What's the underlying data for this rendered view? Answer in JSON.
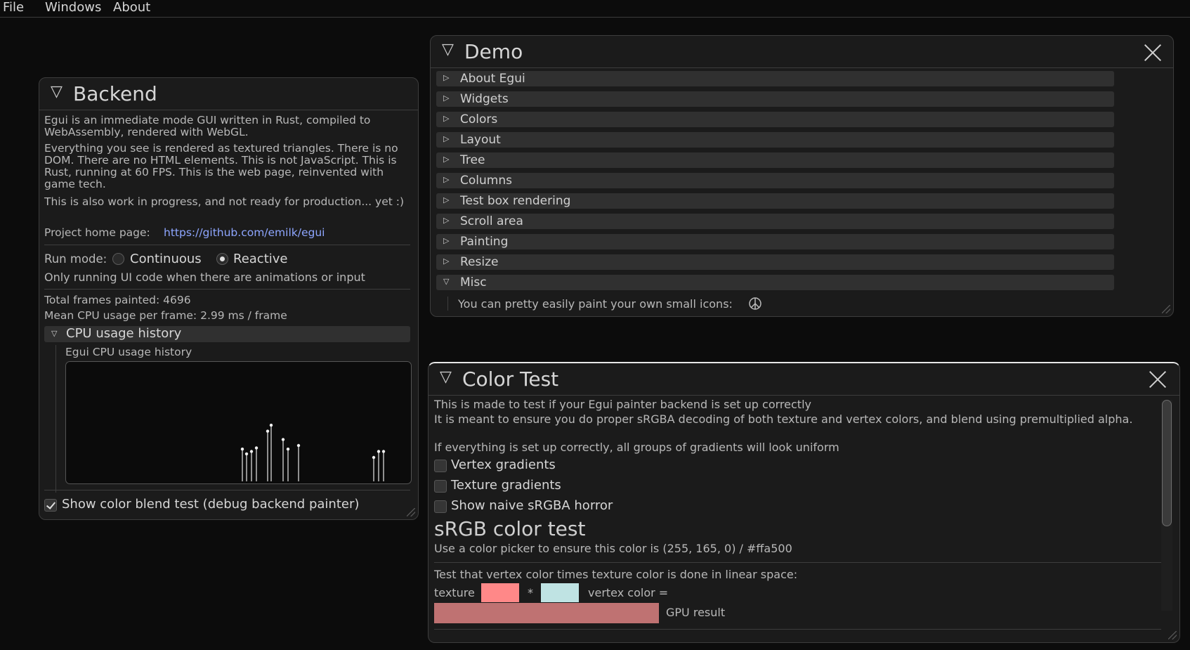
{
  "menu": {
    "file": "File",
    "windows": "Windows",
    "about": "About"
  },
  "backend": {
    "title": "Backend",
    "intro": "Egui is an immediate mode GUI written in Rust, compiled to WebAssembly, rendered with WebGL.",
    "para2": "Everything you see is rendered as textured triangles. There is no DOM. There are no HTML elements. This is not JavaScript. This is Rust, running at 60 FPS. This is the web page, reinvented with game tech.",
    "para3": "This is also work in progress, and not ready for production... yet :)",
    "home_label": "Project home page:",
    "home_link": "https://github.com/emilk/egui",
    "run_mode_label": "Run mode:",
    "run_modes": [
      "Continuous",
      "Reactive"
    ],
    "selected_run_mode": "Reactive",
    "run_mode_note": "Only running UI code when there are animations or input",
    "frames": "Total frames painted: 4696",
    "cpu": "Mean CPU usage per frame: 2.99 ms / frame",
    "cpu_history_header": "CPU usage history",
    "cpu_history_label": "Egui CPU usage history",
    "cpu_history_heights": [
      0.27,
      0.23,
      0.25,
      0.28,
      0.42,
      0.47,
      0.35,
      0.27,
      0.3,
      0.2,
      0.25,
      0.25
    ],
    "show_color_blend": "Show color blend test (debug backend painter)",
    "show_color_blend_checked": true
  },
  "demo": {
    "title": "Demo",
    "items": [
      "About Egui",
      "Widgets",
      "Colors",
      "Layout",
      "Tree",
      "Columns",
      "Test box rendering",
      "Scroll area",
      "Painting",
      "Resize",
      "Misc"
    ],
    "expanded": "Misc",
    "misc_text": "You can pretty easily paint your own small icons:"
  },
  "color_test": {
    "title": "Color Test",
    "line1": "This is made to test if your Egui painter backend is set up correctly",
    "line2": "It is meant to ensure you do proper sRGBA decoding of both texture and vertex colors, and blend using premultiplied alpha.",
    "line3": "If everything is set up correctly, all groups of gradients will look uniform",
    "checkboxes": [
      "Vertex gradients",
      "Texture gradients",
      "Show naive sRGBA horror"
    ],
    "heading": "sRGB color test",
    "picker_note": "Use a color picker to ensure this color is (255, 165, 0) / #ffa500",
    "linear_note": "Test that vertex color times texture color is done in linear space:",
    "texture_label": "texture",
    "times": "*",
    "vertex_label": "vertex color =",
    "gpu_label": "GPU result",
    "colors": {
      "texture": "#ff8888",
      "vertex": "#bfe3e3",
      "gpu_result": "#bf7272"
    }
  }
}
